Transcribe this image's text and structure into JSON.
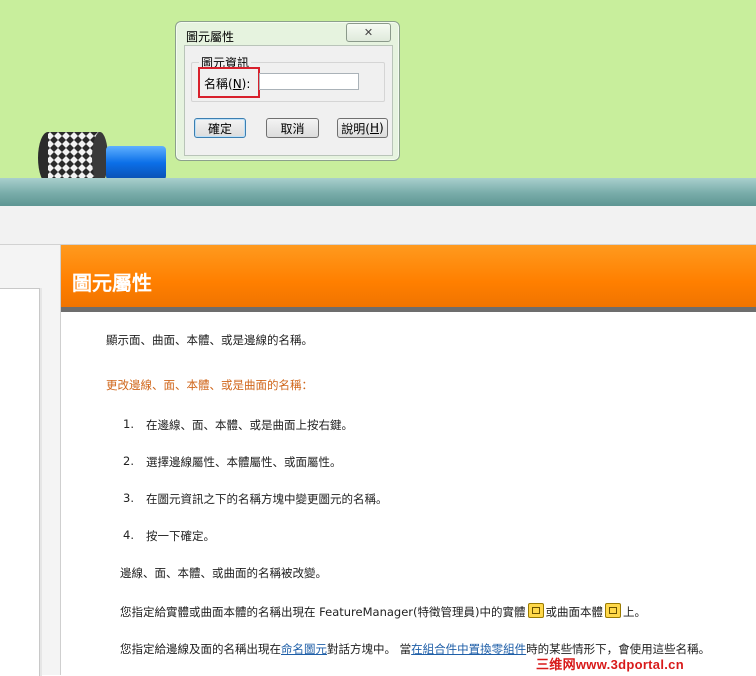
{
  "dialog": {
    "title": "圖元屬性",
    "group_label": "圖元資訊",
    "name_label_prefix": "名稱(",
    "name_label_key": "N",
    "name_label_suffix": "):",
    "name_value": "",
    "ok_label": "確定",
    "cancel_label": "取消",
    "help_prefix": "說明(",
    "help_key": "H",
    "help_suffix": ")"
  },
  "help": {
    "title": "圖元屬性",
    "intro": "顯示面、曲面、本體、或是邊線的名稱。",
    "section_heading": "更改邊線、面、本體、或是曲面的名稱：",
    "steps": [
      {
        "num": "1.",
        "text": "在邊線、面、本體、或是曲面上按右鍵。"
      },
      {
        "num": "2.",
        "text": "選擇邊線屬性、本體屬性、或面屬性。"
      },
      {
        "num": "3.",
        "text": "在圖元資訊之下的名稱方塊中變更圖元的名稱。"
      },
      {
        "num": "4.",
        "text": "按一下確定。"
      }
    ],
    "result": "邊線、面、本體、或曲面的名稱被改變。",
    "note1_a": "您指定給實體或曲面本體的名稱出現在 FeatureManager(特徵管理員)中的實體",
    "note1_b": "或曲面本體",
    "note1_c": "上。",
    "note2_a": "您指定給邊線及面的名稱出現在",
    "note2_link1": "命名圖元",
    "note2_b": "對話方塊中。 當",
    "note2_link2": "在組合件中置換零組件",
    "note2_c": "時的某些情形下，會使用這些名稱。"
  },
  "watermark": "三维网www.3dportal.cn",
  "colors": {
    "background_green": "#c8ee9c",
    "header_orange": "#ff7f00",
    "highlight_red": "#d8202c",
    "link_blue": "#1f5fa8"
  }
}
